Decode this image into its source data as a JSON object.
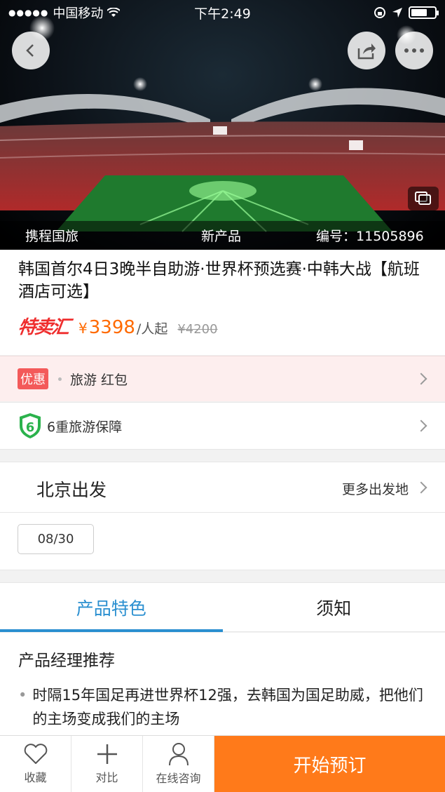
{
  "status_bar": {
    "carrier": "中国移动",
    "time": "下午2:49"
  },
  "hero": {
    "supplier": "携程国旅",
    "tag": "新产品",
    "product_id_label": "编号：",
    "product_id": "11505896",
    "icons": {
      "back": "back-arrow-icon",
      "share": "share-icon",
      "more": "more-dots-icon",
      "gallery": "gallery-icon"
    }
  },
  "product": {
    "title": "韩国首尔4日3晚半自助游·世界杯预选赛·中韩大战【航班酒店可选】",
    "promo_logo": "特卖汇",
    "price_symbol": "¥",
    "price": "3398",
    "price_unit": "/人起",
    "original_price": "¥4200"
  },
  "coupon": {
    "tag": "优惠",
    "text": "旅游 红包"
  },
  "guarantee": {
    "badge_number": "6",
    "text": "6重旅游保障"
  },
  "departure": {
    "city": "北京出发",
    "more_label": "更多出发地",
    "dates": [
      "08/30"
    ]
  },
  "tabs": [
    {
      "label": "产品特色",
      "active": true
    },
    {
      "label": "须知",
      "active": false
    }
  ],
  "content": {
    "heading": "产品经理推荐",
    "bullets": [
      "时隔15年国足再进世界杯12强，去韩国为国足助威，把他们的主场变成我们的主场"
    ]
  },
  "bottom_bar": {
    "favorite": "收藏",
    "compare": "对比",
    "consult": "在线咨询",
    "book": "开始预订"
  },
  "colors": {
    "accent_orange": "#ff7a1a",
    "price_orange": "#ff6a00",
    "tab_blue": "#2a8fd0",
    "coupon_red": "#f35a5a",
    "guarantee_green": "#2bb24c"
  }
}
